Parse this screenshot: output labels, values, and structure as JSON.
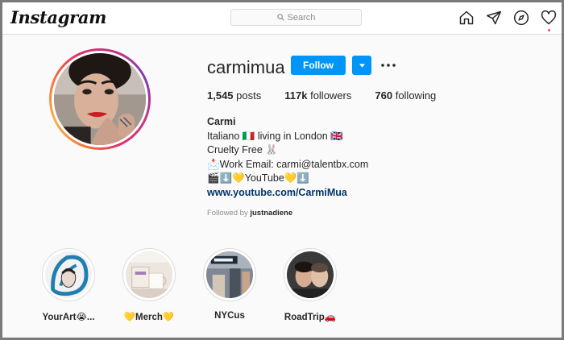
{
  "app": {
    "logo_text": "Instagram"
  },
  "nav": {
    "search_placeholder": "Search",
    "icons": [
      "home-icon",
      "direct-icon",
      "explore-icon",
      "activity-icon"
    ]
  },
  "profile": {
    "username": "carmimua",
    "follow_label": "Follow",
    "stats": {
      "posts_count": "1,545",
      "posts_label": "posts",
      "followers_count": "117k",
      "followers_label": "followers",
      "following_count": "760",
      "following_label": "following"
    },
    "bio": {
      "name": "Carmi",
      "line1": "Italiano 🇮🇹 living in London 🇬🇧",
      "line2": "Cruelty Free 🐰",
      "line3": "📩Work Email: carmi@talentbx.com",
      "line4": "🎬⬇️💛YouTube💛⬇️",
      "link": "www.youtube.com/CarmiMua"
    },
    "followed_by_prefix": "Followed by",
    "followed_by_user": "justnadiene"
  },
  "highlights": [
    {
      "label": "YourArt😭..."
    },
    {
      "label": "💛Merch💛"
    },
    {
      "label": "NYCus"
    },
    {
      "label": "RoadTrip🚗"
    }
  ],
  "colors": {
    "accent": "#0095f6",
    "link": "#00376b",
    "notification": "#ed4956"
  }
}
